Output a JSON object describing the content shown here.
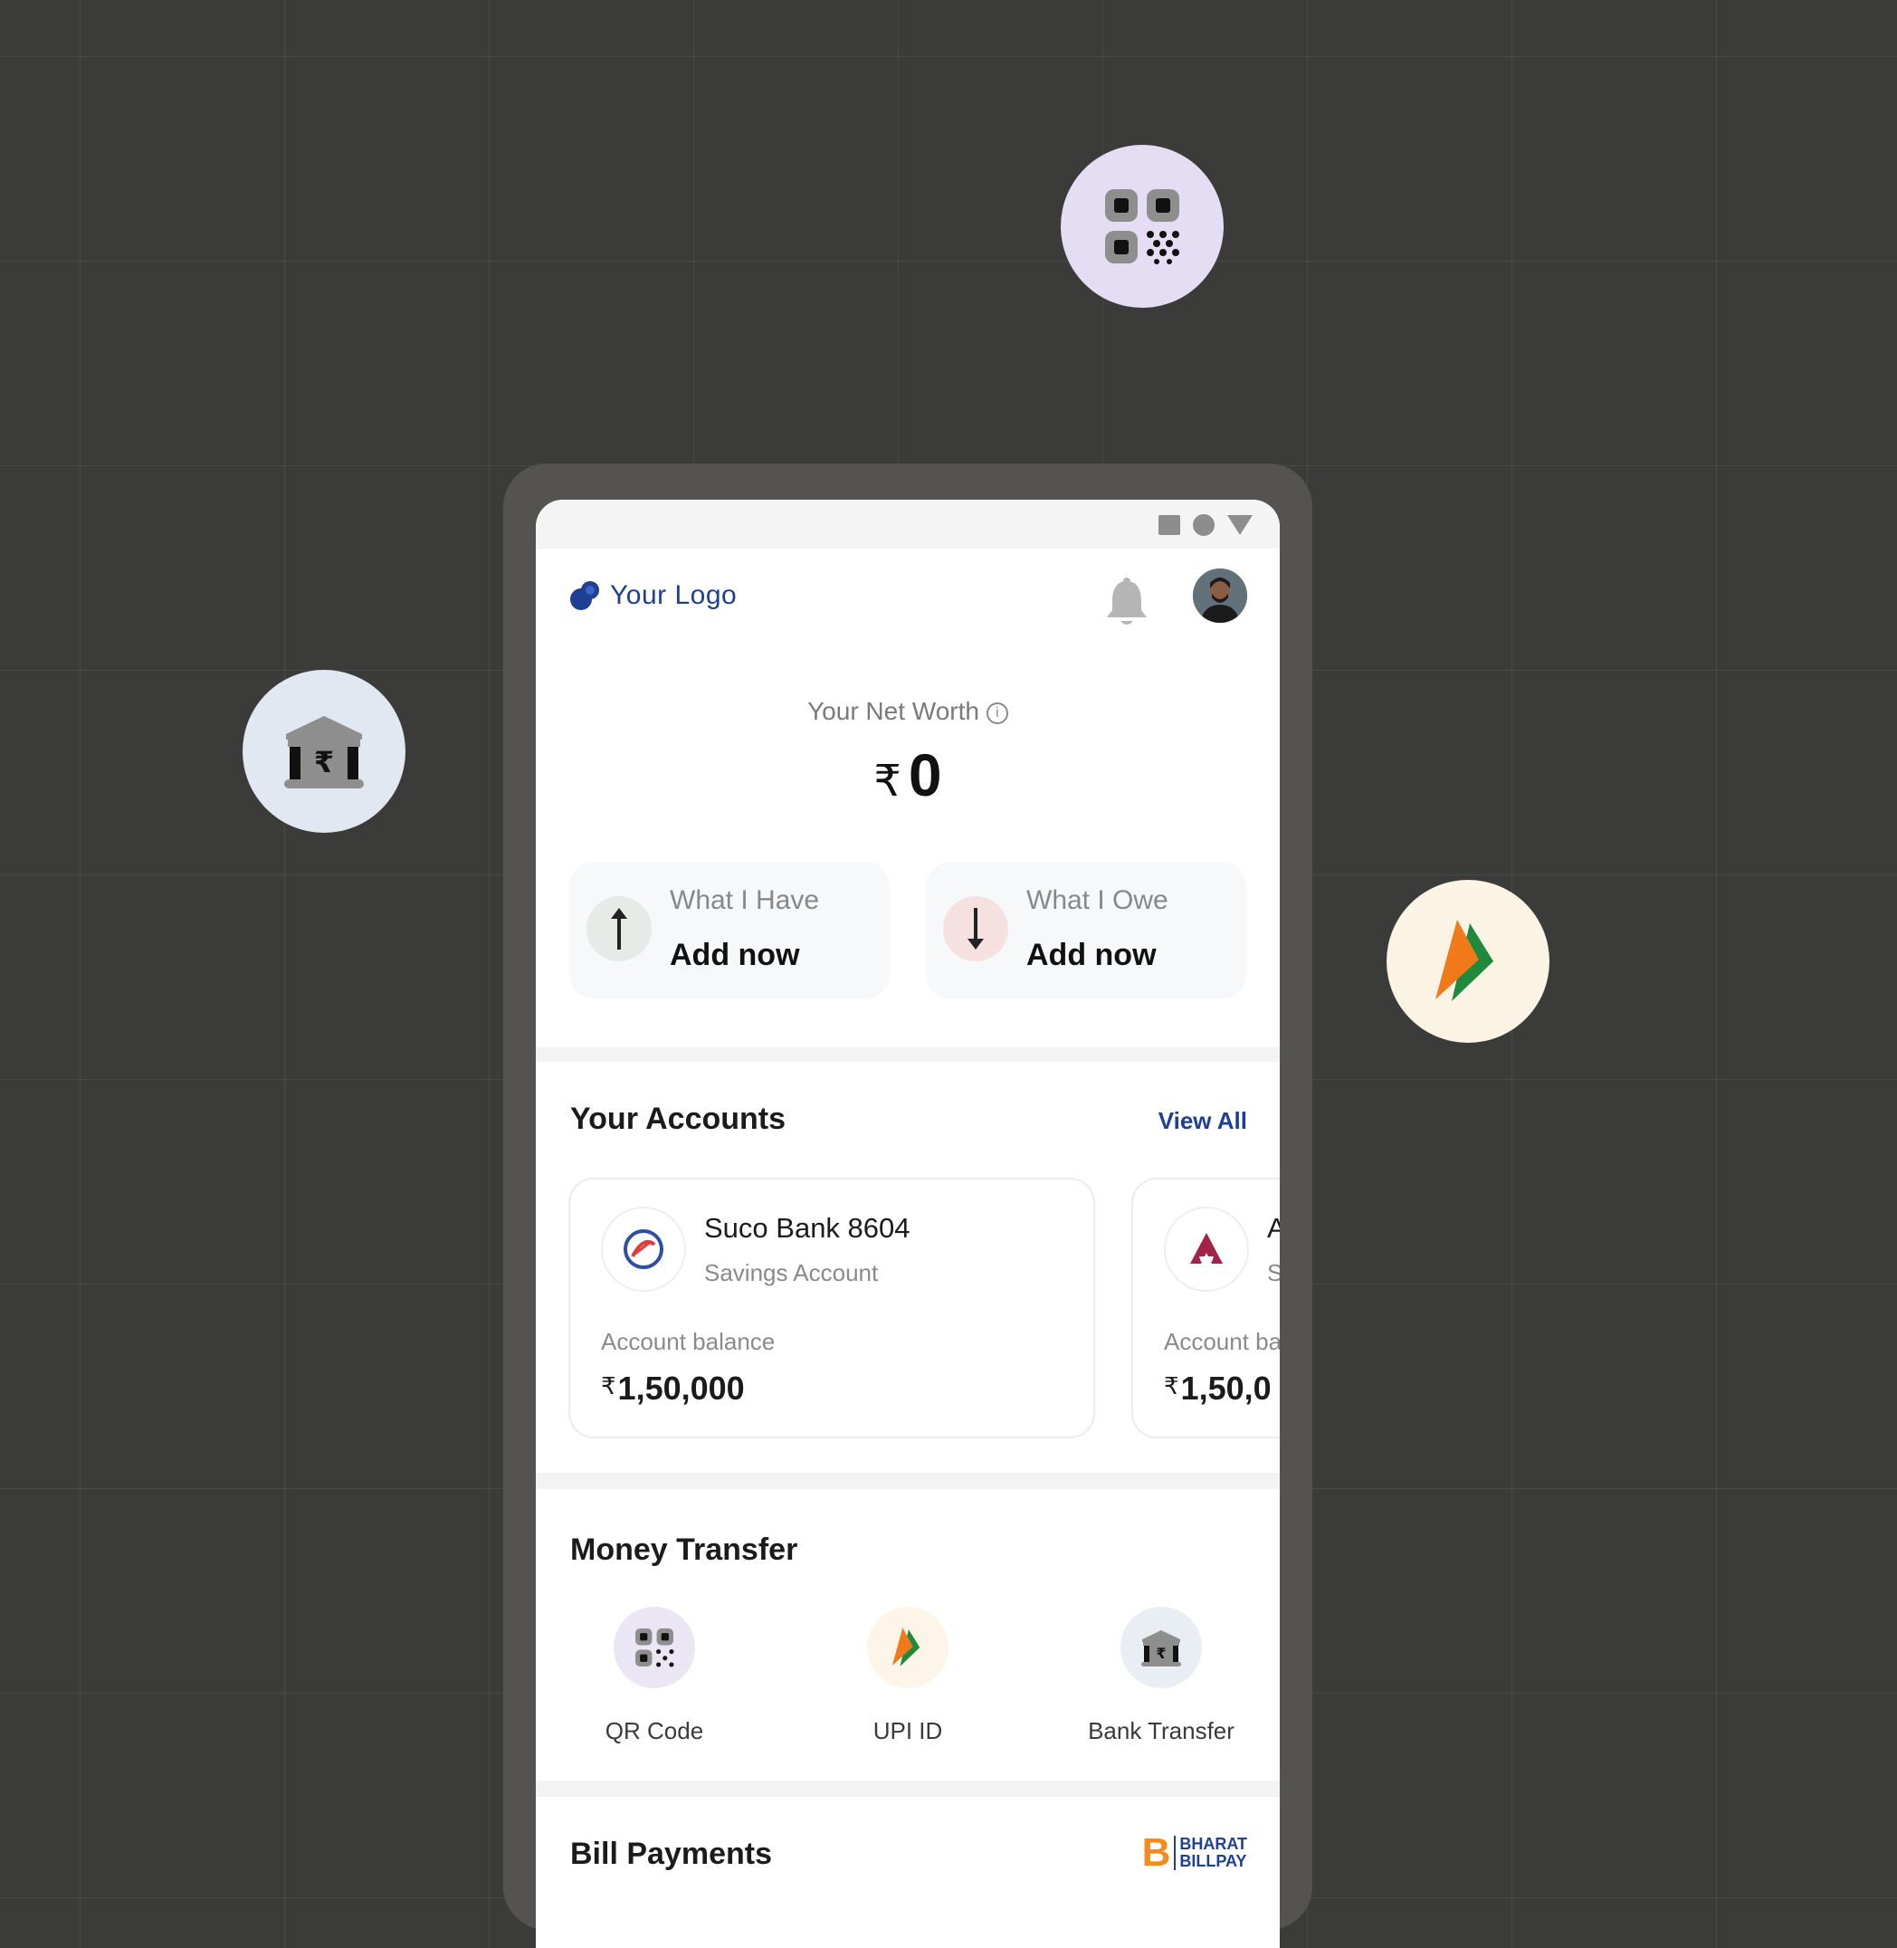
{
  "floating_icons": {
    "qr": "qr-code-icon",
    "bank": "bank-rupee-icon",
    "upi": "upi-logo-icon"
  },
  "header": {
    "logo_text": "Your Logo"
  },
  "net_worth": {
    "label": "Your Net Worth",
    "currency": "₹",
    "value": "0"
  },
  "wealth_cards": [
    {
      "label": "What I Have",
      "action": "Add now"
    },
    {
      "label": "What I Owe",
      "action": "Add now"
    }
  ],
  "accounts": {
    "title": "Your Accounts",
    "view_all": "View All",
    "balance_label": "Account balance",
    "items": [
      {
        "name": "Suco Bank 8604",
        "type": "Savings Account",
        "currency": "₹",
        "balance": "1,50,000"
      },
      {
        "name": "A",
        "type": "S",
        "currency": "₹",
        "balance": "1,50,0"
      }
    ]
  },
  "money_transfer": {
    "title": "Money Transfer",
    "items": [
      {
        "label": "QR Code",
        "icon": "qr-code-icon"
      },
      {
        "label": "UPI ID",
        "icon": "upi-logo-icon"
      },
      {
        "label": "Bank Transfer",
        "icon": "bank-rupee-icon"
      }
    ]
  },
  "bill_payments": {
    "title": "Bill Payments",
    "brand_letter": "B",
    "brand_line1": "BHARAT",
    "brand_line2": "BILLPAY"
  },
  "colors": {
    "background": "#3b3b3a",
    "brand_blue": "#1e3f94",
    "device_frame": "#54534f",
    "upi_orange": "#f07a1a",
    "upi_green": "#1f8a3e"
  }
}
